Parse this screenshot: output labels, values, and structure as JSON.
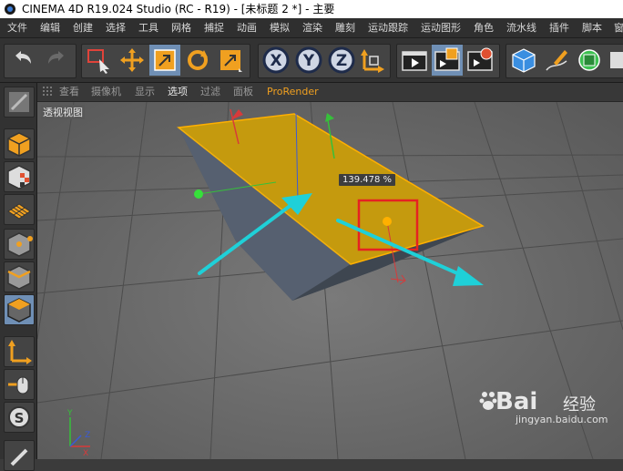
{
  "window": {
    "title": "CINEMA 4D R19.024 Studio (RC - R19) - [未标题 2 *] - 主要"
  },
  "menu": {
    "items": [
      "文件",
      "编辑",
      "创建",
      "选择",
      "工具",
      "网格",
      "捕捉",
      "动画",
      "模拟",
      "渲染",
      "雕刻",
      "运动跟踪",
      "运动图形",
      "角色",
      "流水线",
      "插件",
      "脚本",
      "窗"
    ]
  },
  "viewport_menu": {
    "items": [
      "查看",
      "摄像机",
      "显示",
      "选项",
      "过滤",
      "面板",
      "ProRender"
    ]
  },
  "viewport": {
    "label": "透视视图",
    "scale_readout": "139.478 %"
  },
  "watermark": {
    "brand": "Bai",
    "brand_cn": "经验",
    "url": "jingyan.baidu.com"
  },
  "colors": {
    "plane_top": "#c59a0e",
    "plane_side": "#4f5762",
    "selection_edge": "#ffb000",
    "arrow": "#1fd0d8",
    "highlight_box": "#e52222",
    "axis_x": "#d83a3a",
    "axis_y": "#36c03a",
    "axis_z": "#3a5ad8"
  },
  "toolbar_icons": [
    "undo-icon",
    "redo-icon",
    "live-select-icon",
    "move-icon",
    "scale-icon",
    "rotate-icon",
    "recent-tool-icon",
    "x-axis-lock-icon",
    "y-axis-lock-icon",
    "z-axis-lock-icon",
    "coordinate-system-icon",
    "render-view-icon",
    "render-picture-viewer-icon",
    "render-settings-icon",
    "cube-icon",
    "pen-icon",
    "cloner-icon"
  ],
  "left_tools": [
    "make-editable-icon",
    "model-mode-icon",
    "texture-mode-icon",
    "workplane-mode-icon",
    "points-mode-icon",
    "edges-mode-icon",
    "polygons-mode-icon",
    "enable-axis-icon",
    "tweak-mode-icon",
    "snap-icon"
  ]
}
